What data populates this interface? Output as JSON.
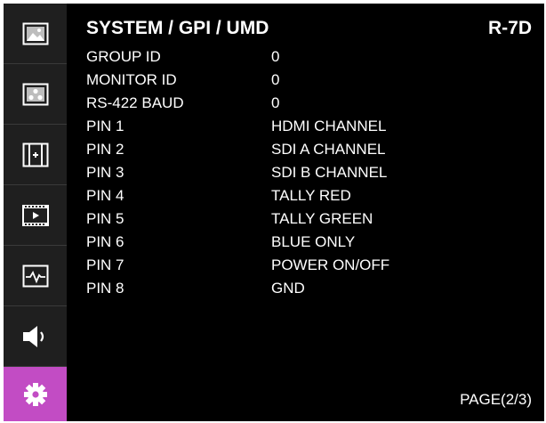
{
  "header": {
    "title": "SYSTEM / GPI / UMD",
    "model": "R-7D"
  },
  "sidebar": {
    "items": [
      {
        "icon": "picture-icon",
        "active": false
      },
      {
        "icon": "color-dots-icon",
        "active": false
      },
      {
        "icon": "marker-icon",
        "active": false
      },
      {
        "icon": "video-frame-icon",
        "active": false
      },
      {
        "icon": "waveform-icon",
        "active": false
      },
      {
        "icon": "speaker-icon",
        "active": false
      },
      {
        "icon": "gear-icon",
        "active": true
      }
    ],
    "active_color": "#c24cc4"
  },
  "settings": [
    {
      "label": "GROUP ID",
      "value": "0"
    },
    {
      "label": "MONITOR ID",
      "value": "0"
    },
    {
      "label": "RS-422 BAUD",
      "value": "0"
    },
    {
      "label": "PIN 1",
      "value": "HDMI CHANNEL"
    },
    {
      "label": "PIN 2",
      "value": "SDI A CHANNEL"
    },
    {
      "label": "PIN 3",
      "value": "SDI B CHANNEL"
    },
    {
      "label": "PIN 4",
      "value": "TALLY RED"
    },
    {
      "label": "PIN 5",
      "value": "TALLY GREEN"
    },
    {
      "label": "PIN 6",
      "value": "BLUE ONLY"
    },
    {
      "label": "PIN 7",
      "value": "POWER ON/OFF"
    },
    {
      "label": "PIN 8",
      "value": "GND"
    }
  ],
  "footer": {
    "page": "PAGE(2/3)"
  }
}
